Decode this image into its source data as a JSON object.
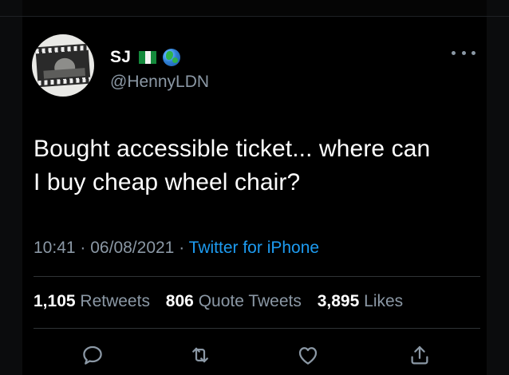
{
  "tweet": {
    "display_name": "SJ",
    "handle": "@HennyLDN",
    "text_line1": "Bought accessible ticket... where can",
    "text_line2": "I buy cheap wheel chair?",
    "time": "10:41",
    "date": "06/08/2021",
    "separator": "·",
    "source": "Twitter for iPhone",
    "retweets_count": "1,105",
    "retweets_label": "Retweets",
    "quotes_count": "806",
    "quotes_label": "Quote Tweets",
    "likes_count": "3,895",
    "likes_label": "Likes"
  },
  "icons": {
    "name_badges": [
      "nigeria-flag-icon",
      "globe-icon"
    ],
    "more": "more-options-icon",
    "actions": [
      "reply-icon",
      "retweet-icon",
      "like-icon",
      "share-icon"
    ]
  },
  "colors": {
    "background": "#000000",
    "primary_text": "#ffffff",
    "secondary_text": "#8b98a5",
    "link": "#1d9bf0",
    "divider": "#2f3336"
  }
}
